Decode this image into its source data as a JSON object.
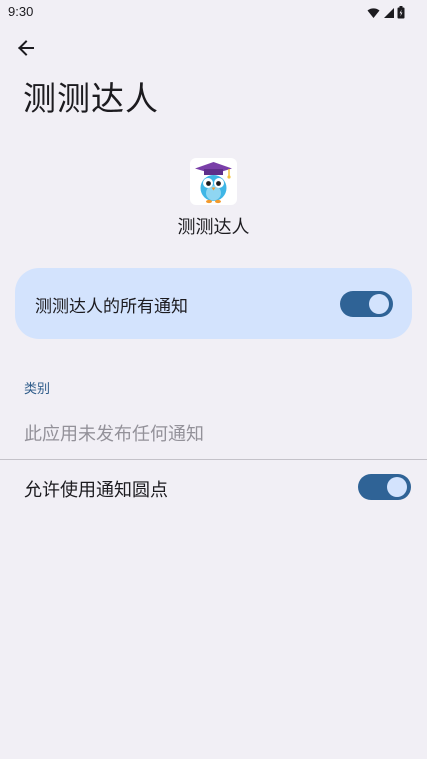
{
  "status_bar": {
    "time": "9:30",
    "icons": [
      "wifi-icon",
      "signal-icon",
      "battery-icon"
    ]
  },
  "header": {
    "back_icon": "arrow-left-icon",
    "title": "测测达人"
  },
  "app": {
    "icon": "owl-graduate-app-icon",
    "name": "测测达人"
  },
  "main_toggle": {
    "label": "测测达人的所有通知",
    "checked": true
  },
  "categories": {
    "header": "类别",
    "empty_message": "此应用未发布任何通知"
  },
  "notification_dot": {
    "label": "允许使用通知圆点",
    "checked": true
  },
  "colors": {
    "background": "#f1eff5",
    "card": "#d3e3fd",
    "switch_track": "#2f6396",
    "section_header": "#2f5c8a"
  }
}
